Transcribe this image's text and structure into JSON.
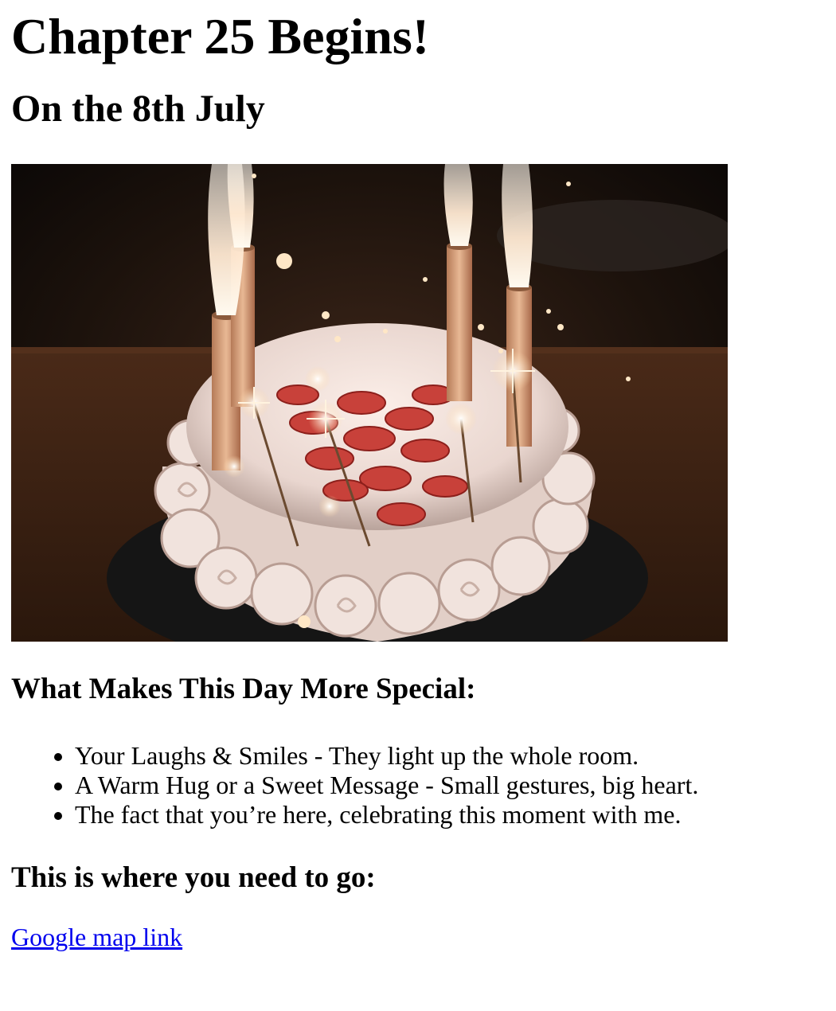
{
  "header": {
    "title": "Chapter 25 Begins!",
    "subtitle": "On the 8th July"
  },
  "hero_image": {
    "icon": "birthday-cake-photo",
    "colors": {
      "background": "#1a0f0a",
      "frosting": "#f3e8e4",
      "strawberry": "#c8413a",
      "candle": "#d9a07a"
    }
  },
  "special_section": {
    "heading": "What Makes This Day More Special:",
    "items": [
      "Your Laughs & Smiles - They light up the whole room.",
      "A Warm Hug or a Sweet Message - Small gestures, big heart.",
      "The fact that you’re here, celebrating this moment with me."
    ]
  },
  "location_section": {
    "heading": "This is where you need to go:",
    "link_label": "Google map link"
  }
}
